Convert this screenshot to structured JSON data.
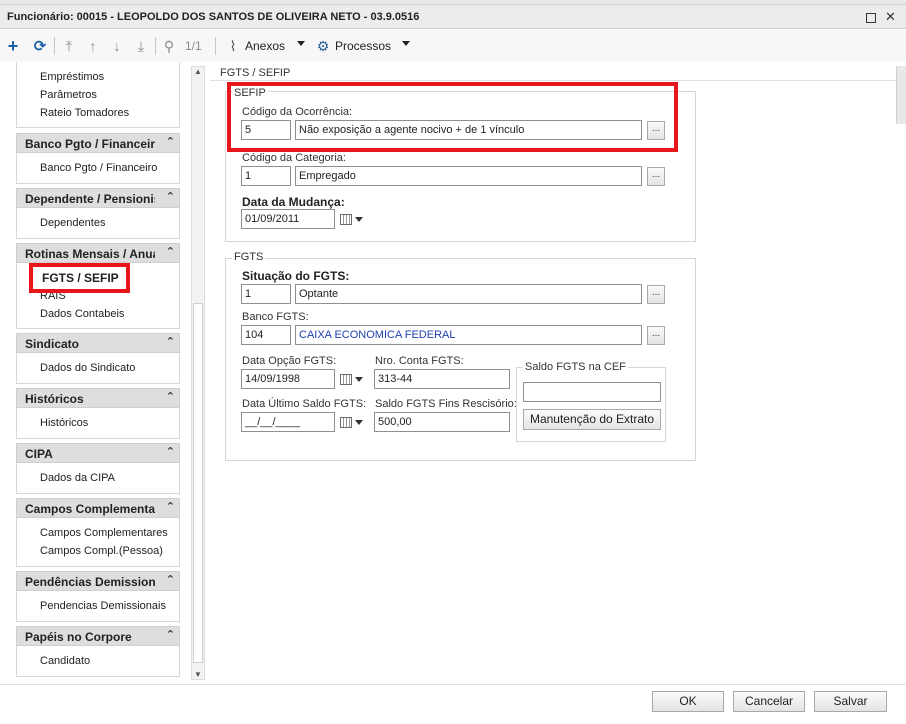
{
  "window": {
    "title": "Funcionário: 00015 - LEOPOLDO DOS SANTOS DE OLIVEIRA NETO - 03.9.0516",
    "max_glyph": "",
    "close_glyph": "✕"
  },
  "toolbar": {
    "record_counter": "1/1",
    "anexos_label": "Anexos",
    "processos_label": "Processos",
    "icons": [
      "plus-icon",
      "refresh-icon",
      "first-record-icon",
      "previous-record-icon",
      "next-record-icon",
      "last-record-icon",
      "search-icon",
      "paperclip-icon",
      "gear-icon"
    ]
  },
  "sidebar": {
    "top_items": [
      "Empréstimos",
      "Parâmetros",
      "Rateio Tomadores"
    ],
    "groups": [
      {
        "title": "Banco Pgto / Financeiro",
        "items": [
          "Banco Pgto / Financeiro"
        ]
      },
      {
        "title": "Dependente / Pensionista",
        "items": [
          "Dependentes"
        ]
      },
      {
        "title": "Rotinas Mensais / Anuais",
        "items": [
          "FGTS / SEFIP",
          "RAIS",
          "Dados Contabeis"
        ]
      },
      {
        "title": "Sindicato",
        "items": [
          "Dados do Sindicato"
        ]
      },
      {
        "title": "Históricos",
        "items": [
          "Históricos"
        ]
      },
      {
        "title": "CIPA",
        "items": [
          "Dados da CIPA"
        ]
      },
      {
        "title": "Campos Complementares",
        "items": [
          "Campos Complementares",
          "Campos Compl.(Pessoa)"
        ]
      },
      {
        "title": "Pendências Demissionais",
        "items": [
          "Pendencias Demissionais"
        ]
      },
      {
        "title": "Papéis no Corpore",
        "items": [
          "Candidato"
        ]
      }
    ],
    "collapse_glyph": "⌃"
  },
  "panel": {
    "title": "FGTS / SEFIP",
    "sefip": {
      "legend": "SEFIP",
      "ocorrencia_label": "Código da Ocorrência:",
      "ocorrencia_code": "5",
      "ocorrencia_desc": "Não exposição a agente nocivo + de 1 vínculo",
      "categoria_label": "Código da Categoria:",
      "categoria_code": "1",
      "categoria_desc": "Empregado",
      "mudanca_label": "Data da Mudança:",
      "mudanca_value": "01/09/2011"
    },
    "fgts": {
      "legend": "FGTS",
      "situacao_label": "Situação do FGTS:",
      "situacao_code": "1",
      "situacao_desc": "Optante",
      "banco_label": "Banco FGTS:",
      "banco_code": "104",
      "banco_desc": "CAIXA ECONOMICA FEDERAL",
      "data_opcao_label": "Data Opção FGTS:",
      "data_opcao_value": "14/09/1998",
      "nro_conta_label": "Nro. Conta FGTS:",
      "nro_conta_value": "313-44",
      "data_saldo_label": "Data Último Saldo FGTS:",
      "data_saldo_value": "__/__/____",
      "saldo_fins_label": "Saldo FGTS Fins Rescisório:",
      "saldo_fins_value": "500,00",
      "saldo_cef_legend": "Saldo FGTS na CEF",
      "saldo_cef_value": "",
      "extrato_button": "Manutenção do Extrato"
    },
    "lookup_glyph": "..."
  },
  "footer": {
    "ok": "OK",
    "cancel": "Cancelar",
    "save": "Salvar"
  }
}
